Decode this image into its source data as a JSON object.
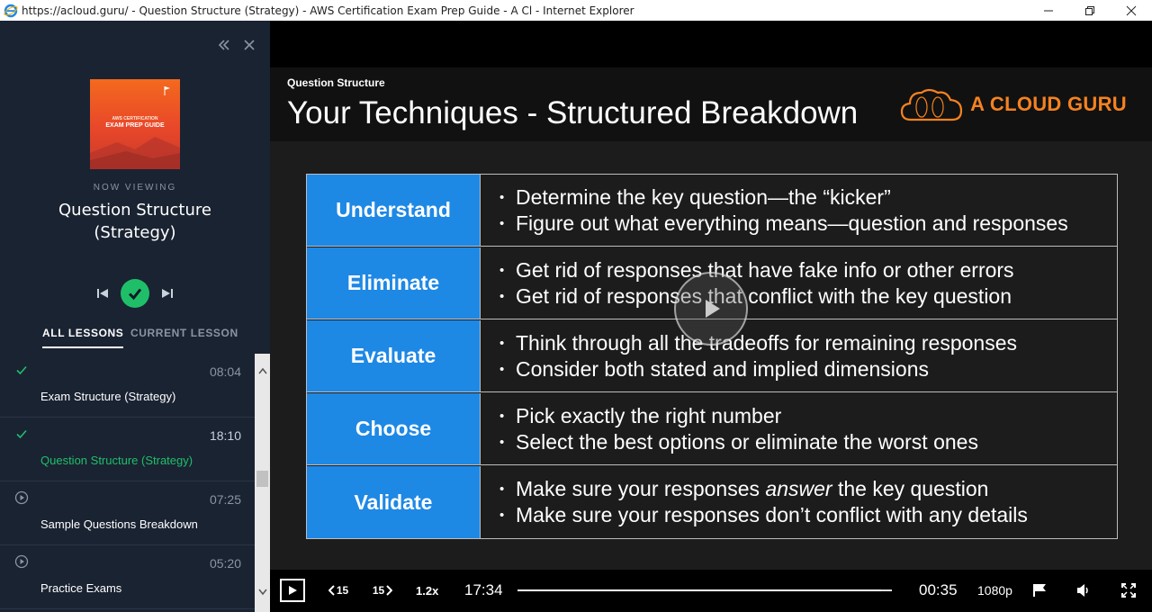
{
  "window": {
    "title": "https://acloud.guru/ - Question Structure (Strategy) - AWS Certification Exam Prep Guide - A Cl - Internet Explorer"
  },
  "sidebar": {
    "course_cover": {
      "small_text": "AWS CERTIFICATION",
      "big_text": "EXAM PREP GUIDE"
    },
    "now_viewing_label": "NOW VIEWING",
    "current_title": "Question Structure (Strategy)",
    "tabs": [
      {
        "label": "ALL LESSONS",
        "active": true
      },
      {
        "label": "CURRENT LESSON",
        "active": false
      }
    ],
    "lessons": [
      {
        "status": "completed",
        "duration": "08:04",
        "title": "Exam Structure (Strategy)",
        "current": false
      },
      {
        "status": "completed",
        "duration": "18:10",
        "title": "Question Structure (Strategy)",
        "current": true
      },
      {
        "status": "unplayed",
        "duration": "07:25",
        "title": "Sample Questions Breakdown",
        "current": false
      },
      {
        "status": "unplayed",
        "duration": "05:20",
        "title": "Practice Exams",
        "current": false
      }
    ]
  },
  "slide": {
    "kicker": "Question Structure",
    "title": "Your Techniques - Structured Breakdown",
    "brand": "A CLOUD GURU",
    "rows": [
      {
        "key": "Understand",
        "points": [
          "Determine the key question—the “kicker”",
          "Figure out what everything means—question and responses"
        ]
      },
      {
        "key": "Eliminate",
        "points": [
          "Get rid of responses that have fake info or other errors",
          "Get rid of responses that conflict with the key question"
        ]
      },
      {
        "key": "Evaluate",
        "points": [
          "Think through all the tradeoffs for remaining responses",
          "Consider both stated and implied dimensions"
        ]
      },
      {
        "key": "Choose",
        "points": [
          "Pick exactly the right number",
          "Select the best options or eliminate the worst ones"
        ]
      },
      {
        "key": "Validate",
        "points_html": [
          "Make sure your responses <i>answer</i> the key question"
        ],
        "points": [
          "Make sure your responses answer the key question",
          "Make sure your responses don’t conflict with any details"
        ]
      }
    ]
  },
  "player": {
    "rewind_label": "15",
    "forward_label": "15",
    "speed": "1.2x",
    "elapsed": "17:34",
    "remaining": "00:35",
    "quality": "1080p",
    "progress": 0.97
  },
  "colors": {
    "sidebar_bg": "#1a2332",
    "accent_green": "#1fbf6a",
    "brand_orange": "#f58220",
    "cell_blue": "#1e88e5"
  }
}
